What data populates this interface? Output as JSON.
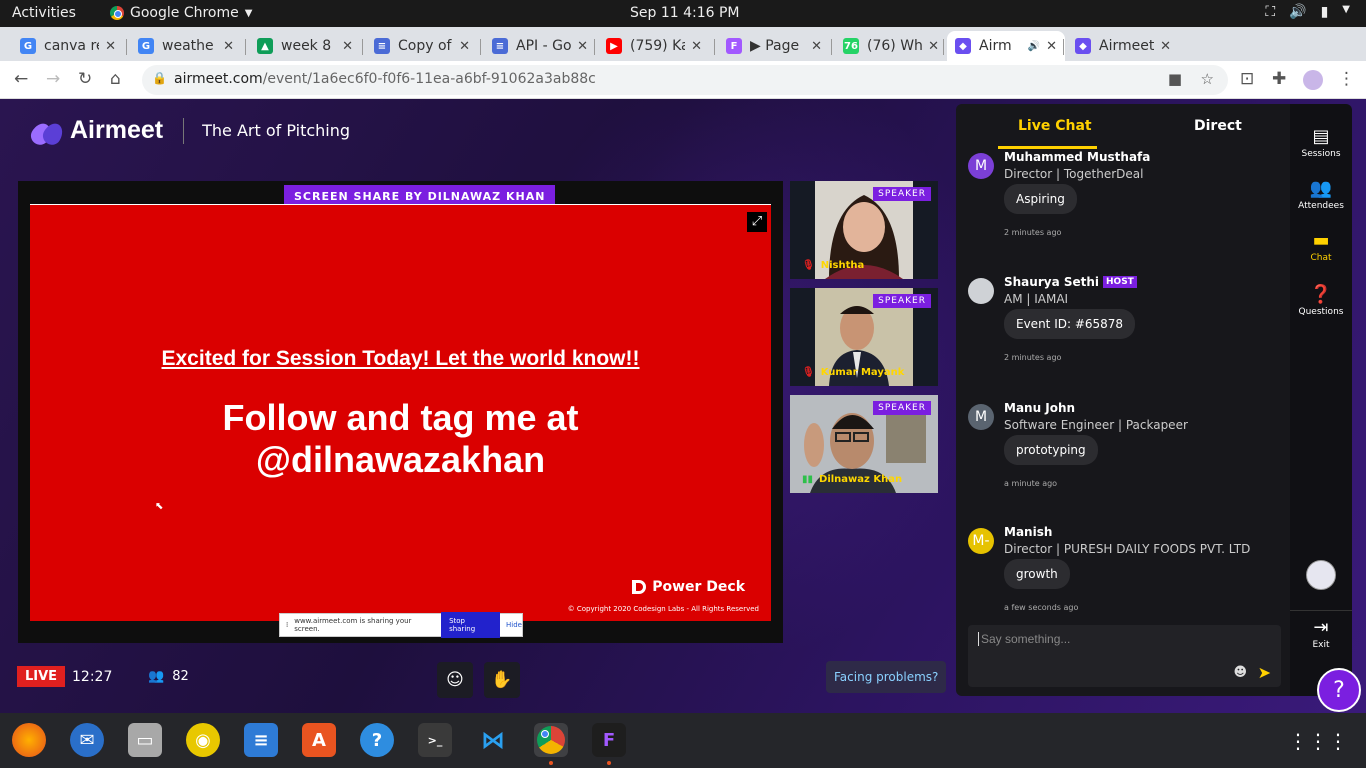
{
  "system": {
    "activities": "Activities",
    "app_name": "Google Chrome",
    "clock": "Sep 11   4:16 PM"
  },
  "browser": {
    "tabs": [
      {
        "title": "canva re",
        "color": "#4285f4",
        "glyph": "G"
      },
      {
        "title": "weathe",
        "color": "#4285f4",
        "glyph": "G"
      },
      {
        "title": "week 8",
        "color": "#0f9d58",
        "glyph": "▲"
      },
      {
        "title": "Copy of",
        "color": "#4b6bd6",
        "glyph": "≡"
      },
      {
        "title": "API - Go",
        "color": "#4b6bd6",
        "glyph": "≡"
      },
      {
        "title": "(759) Ka",
        "color": "#ff0000",
        "glyph": "▶"
      },
      {
        "title": "▶ Page",
        "color": "#a259ff",
        "glyph": "F"
      },
      {
        "title": "(76) Wh",
        "color": "#25d366",
        "glyph": "76"
      },
      {
        "title": "Airm",
        "color": "#6a4ff0",
        "glyph": "◆"
      },
      {
        "title": "Airmeet",
        "color": "#6a4ff0",
        "glyph": "◆"
      }
    ],
    "active_tab_index": 8,
    "url_host": "airmeet.com",
    "url_path": "/event/1a6ec6f0-f0f6-11ea-a6bf-91062a3ab88c"
  },
  "event": {
    "brand": "Airmeet",
    "title": "The Art of Pitching",
    "share_badge": "SCREEN SHARE BY DILNAWAZ KHAN",
    "slide": {
      "heading": "Excited for Session Today! Let the world know!!",
      "line1": "Follow and tag me at",
      "line2": "@dilnawazakhan",
      "brand": "Power Deck",
      "copyright": "© Copyright 2020  Codesign Labs  - All Rights Reserved"
    },
    "share_notice": {
      "text": "www.airmeet.com is sharing your screen.",
      "stop": "Stop sharing",
      "hide": "Hide"
    },
    "speakers": [
      {
        "name": "Nishtha",
        "tag": "SPEAKER",
        "mic": "muted"
      },
      {
        "name": "Kumar Mayank",
        "tag": "SPEAKER",
        "mic": "muted"
      },
      {
        "name": "Dilnawaz Khan",
        "tag": "SPEAKER",
        "mic": "active"
      }
    ],
    "live_label": "LIVE",
    "elapsed": "12:27",
    "attendee_count": "82",
    "facing_problems": "Facing problems?"
  },
  "chat": {
    "tab_live": "Live Chat",
    "tab_direct": "Direct",
    "messages": [
      {
        "name": "Muhammed Musthafa",
        "initial": "M",
        "avatar_color": "#7b3fd6",
        "role": "Director | TogetherDeal",
        "text": "Aspiring",
        "time": "2 minutes ago",
        "host": ""
      },
      {
        "name": "Shaurya Sethi",
        "initial": "",
        "avatar_color": "#cfd2d6",
        "role": "AM | IAMAI",
        "text": "Event ID: #65878",
        "time": "2 minutes ago",
        "host": "HOST"
      },
      {
        "name": "Manu John",
        "initial": "M",
        "avatar_color": "#5a6470",
        "role": "Software Engineer | Packapeer",
        "text": "prototyping",
        "time": "a minute ago",
        "host": ""
      },
      {
        "name": "Manish",
        "initial": "M-",
        "avatar_color": "#e6c200",
        "role": "Director | PURESH DAILY FOODS PVT. LTD",
        "text": "growth",
        "time": "a few seconds ago",
        "host": ""
      }
    ],
    "input_placeholder": "Say something..."
  },
  "rail": {
    "sessions": "Sessions",
    "attendees": "Attendees",
    "chat": "Chat",
    "questions": "Questions",
    "exit": "Exit"
  },
  "colors": {
    "accent_purple": "#7b1fe0",
    "accent_yellow": "#ffd100",
    "live_red": "#e0201f",
    "slide_red": "#da0000"
  }
}
